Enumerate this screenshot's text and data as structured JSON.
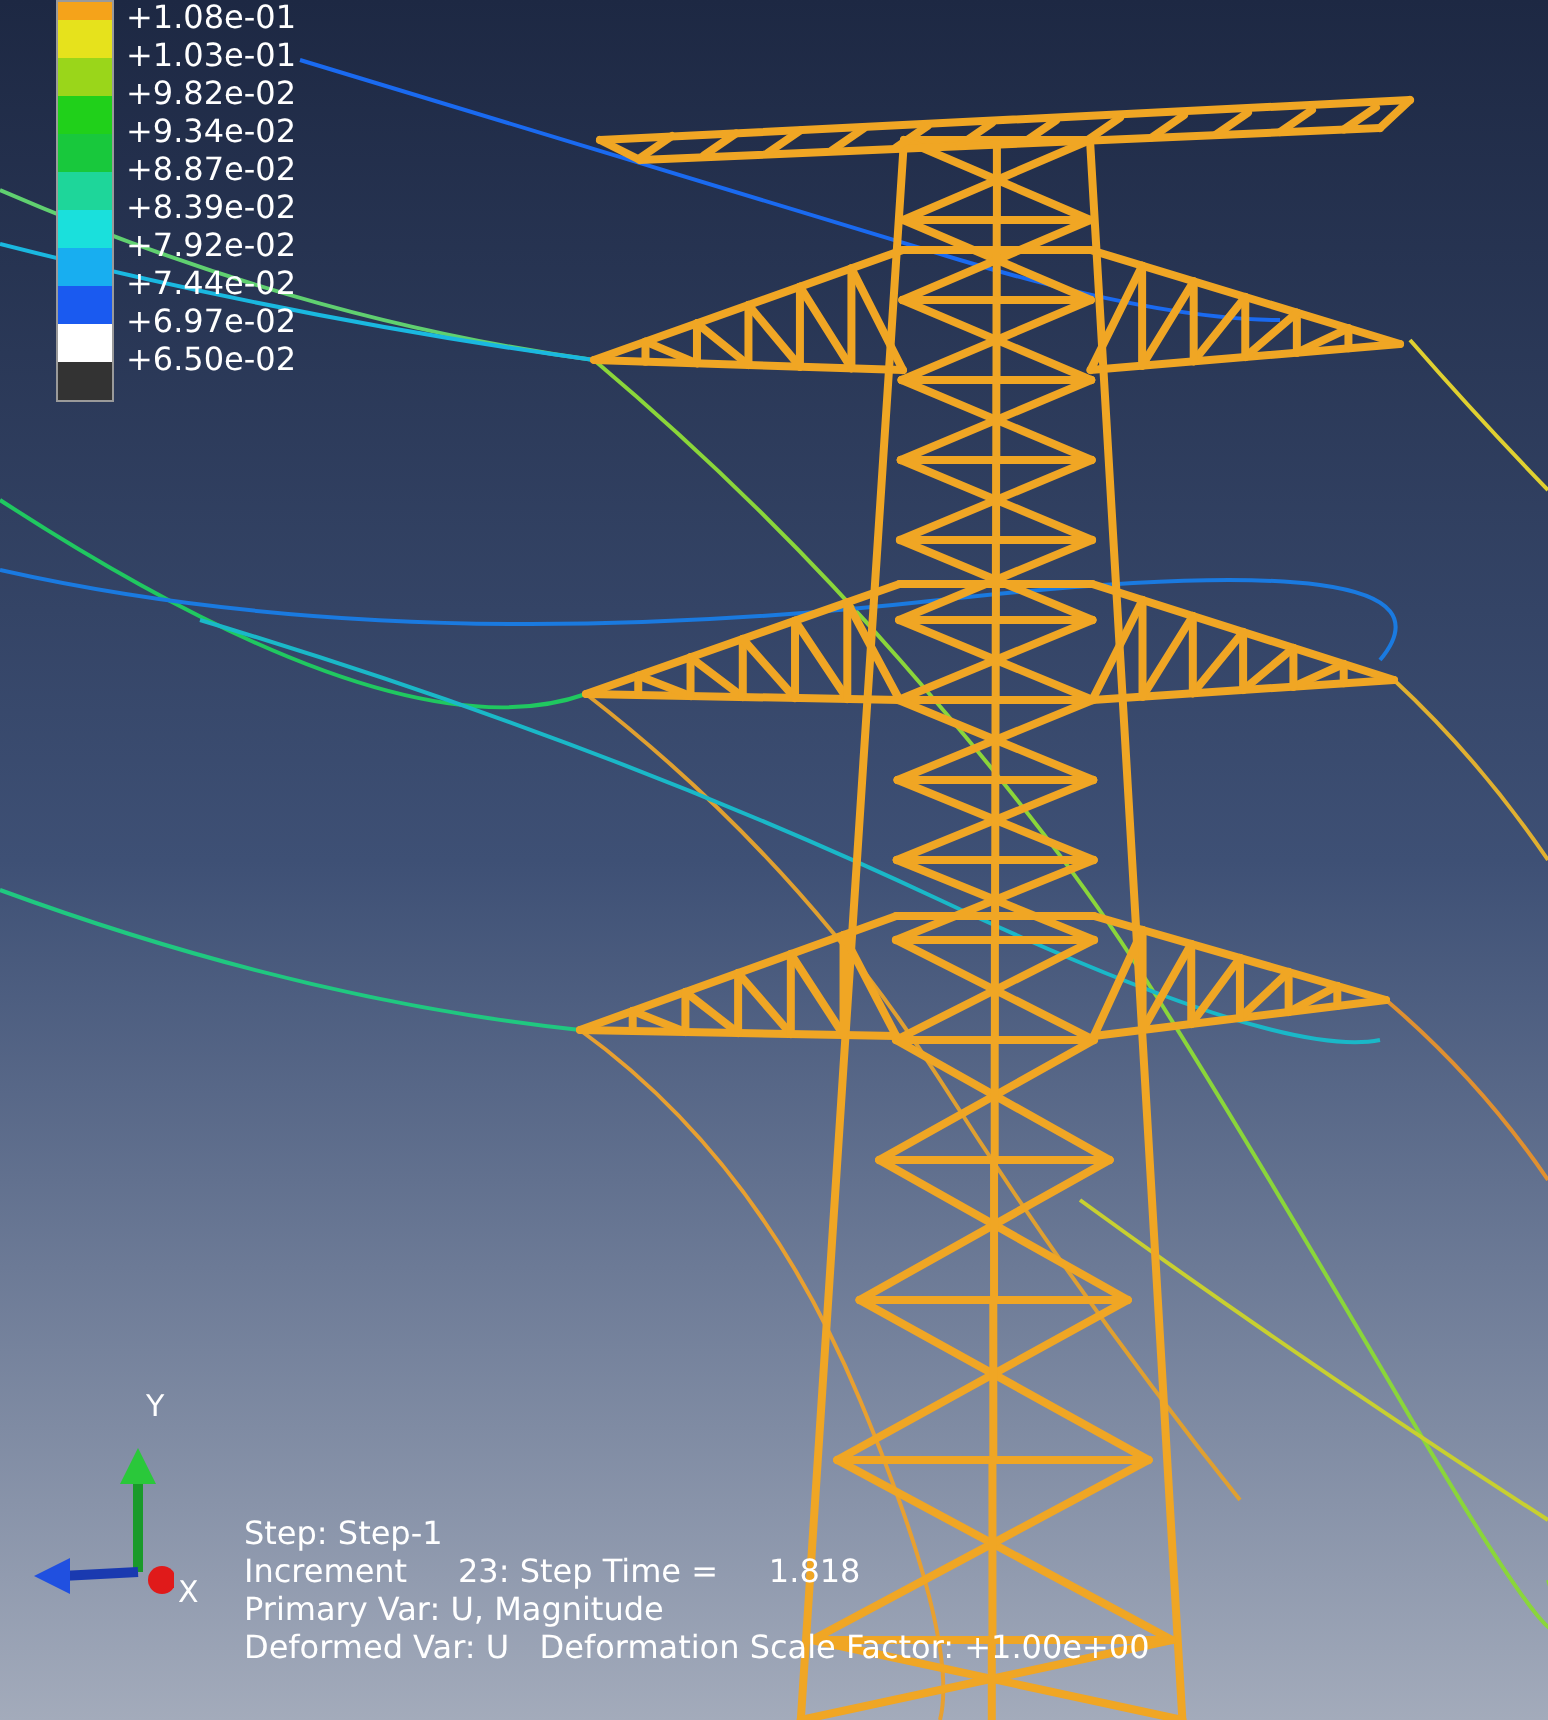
{
  "legend": {
    "bands": [
      {
        "color": "#f5a31a"
      },
      {
        "color": "#e6e21c"
      },
      {
        "color": "#9ad61a"
      },
      {
        "color": "#20d01a"
      },
      {
        "color": "#18c83c"
      },
      {
        "color": "#1ed69a"
      },
      {
        "color": "#1ae0dc"
      },
      {
        "color": "#18aef0"
      },
      {
        "color": "#1a5af0"
      },
      {
        "color": "#ffffff"
      },
      {
        "color": "#333333"
      }
    ],
    "ticks": [
      "+1.08e-01",
      "+1.03e-01",
      "+9.82e-02",
      "+9.34e-02",
      "+8.87e-02",
      "+8.39e-02",
      "+7.92e-02",
      "+7.44e-02",
      "+6.97e-02",
      "+6.50e-02"
    ]
  },
  "triad": {
    "y_label": "Y",
    "x_label": "X"
  },
  "info": [
    "Step: Step-1",
    "Increment     23: Step Time =     1.818",
    "Primary Var: U, Magnitude",
    "Deformed Var: U   Deformation Scale Factor: +1.00e+00"
  ]
}
